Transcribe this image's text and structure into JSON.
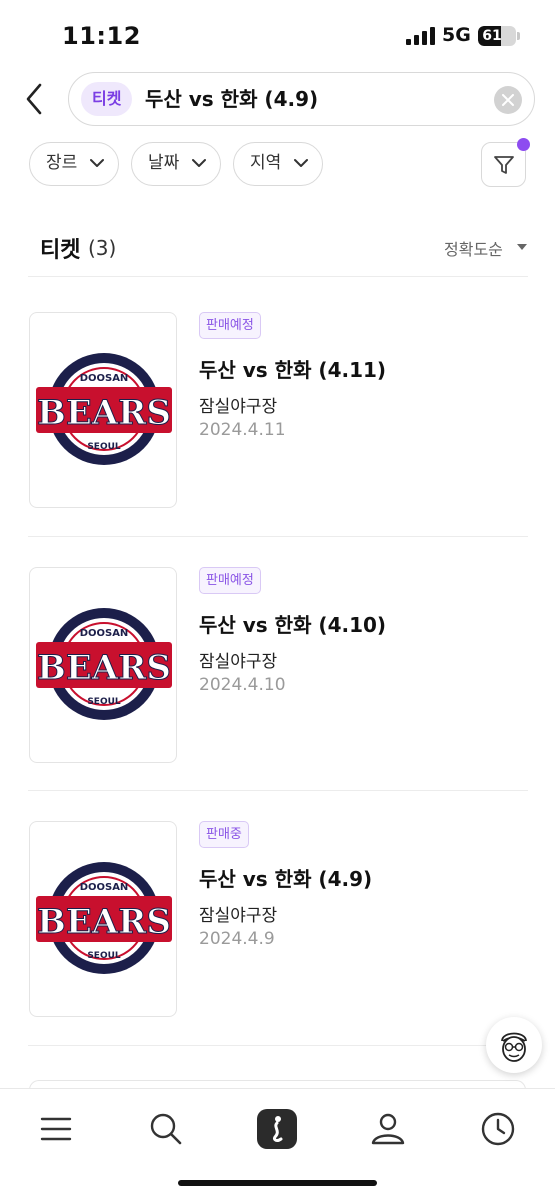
{
  "status_bar": {
    "time": "11:12",
    "network": "5G",
    "battery": "61",
    "battery_level": 0.61
  },
  "search": {
    "chip": "티켓",
    "query": "두산 vs 한화 (4.9)"
  },
  "filters": [
    {
      "label": "장르"
    },
    {
      "label": "날짜"
    },
    {
      "label": "지역"
    }
  ],
  "section": {
    "title": "티켓",
    "count": "(3)",
    "sort": "정확도순"
  },
  "tickets": [
    {
      "badge": "판매예정",
      "title": "두산 vs 한화 (4.11)",
      "venue": "잠실야구장",
      "date": "2024.4.11"
    },
    {
      "badge": "판매예정",
      "title": "두산 vs 한화 (4.10)",
      "venue": "잠실야구장",
      "date": "2024.4.10"
    },
    {
      "badge": "판매중",
      "title": "두산 vs 한화 (4.9)",
      "venue": "잠실야구장",
      "date": "2024.4.9"
    }
  ],
  "logo": {
    "top": "DOOSAN",
    "main": "BEARS",
    "bottom": "SEOUL"
  },
  "colors": {
    "accent": "#8d4cf0",
    "badge_text": "#8a55e6",
    "logo_navy": "#1c1f4a",
    "logo_red": "#c8102e"
  },
  "bottom_nav": [
    {
      "icon": "menu-icon"
    },
    {
      "icon": "search-icon"
    },
    {
      "icon": "home-app-icon"
    },
    {
      "icon": "profile-icon"
    },
    {
      "icon": "history-clock-icon"
    }
  ]
}
